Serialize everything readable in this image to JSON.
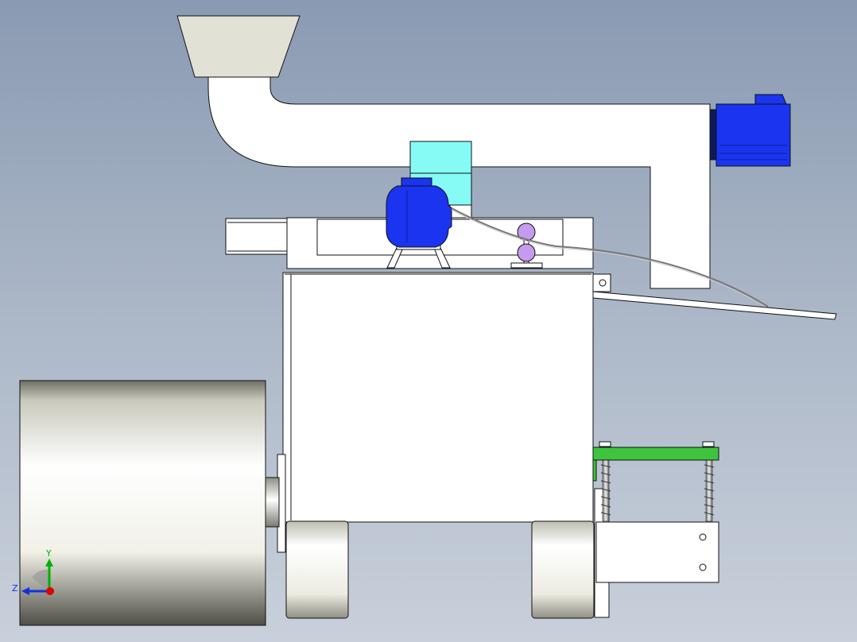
{
  "viewport": {
    "background_top": "#8a9ab2",
    "background_bottom": "#c9d0db"
  },
  "colors": {
    "part_fill": "#ffffff",
    "edge": "#111111",
    "hopper": "#e2e1d6",
    "servo_motor": "#1b34f0",
    "cyan_block": "#86fbf6",
    "purple_pulley": "#c49bef",
    "green_plate": "#3ec43e",
    "metal_light": "#ffffff",
    "metal_dark": "#5f5f55"
  },
  "icons": {
    "triad": "xyz-triad-icon",
    "servo": "servo-motor-icon",
    "hopper": "hopper-icon"
  },
  "triad": {
    "y_label": "Y",
    "z_label": "Z",
    "y_color": "#00b000",
    "z_color": "#1030e0",
    "x_color": "#e00000"
  }
}
